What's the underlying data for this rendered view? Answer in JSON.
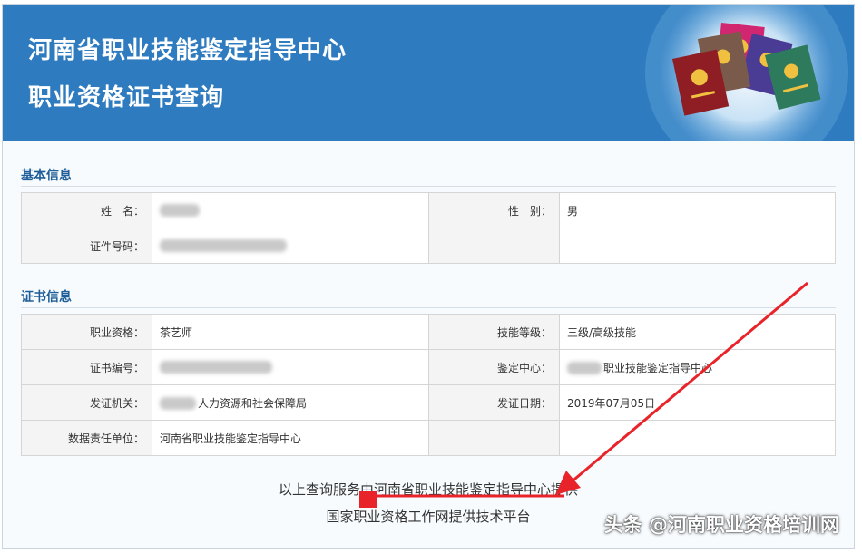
{
  "header": {
    "title_line1": "河南省职业技能鉴定指导中心",
    "title_line2": "职业资格证书查询"
  },
  "basic_info": {
    "section_title": "基本信息",
    "rows": [
      {
        "label": "姓　名：",
        "value": "",
        "label2": "性　别：",
        "value2": "男"
      },
      {
        "label": "证件号码：",
        "value": "",
        "label2": "",
        "value2": ""
      }
    ]
  },
  "cert_info": {
    "section_title": "证书信息",
    "rows": [
      {
        "label": "职业资格：",
        "value": "茶艺师",
        "label2": "技能等级：",
        "value2": "三级/高级技能"
      },
      {
        "label": "证书编号：",
        "value": "",
        "label2": "鉴定中心：",
        "value2": "职业技能鉴定指导中心"
      },
      {
        "label": "发证机关：",
        "value": "人力资源和社会保障局",
        "label2": "发证日期：",
        "value2": "2019年07月05日"
      },
      {
        "label": "数据责任单位：",
        "value": "河南省职业技能鉴定指导中心",
        "label2": "",
        "value2": ""
      }
    ]
  },
  "footer": {
    "line1": "以上查询服务由河南省职业技能鉴定指导中心提供",
    "line2": "国家职业资格工作网提供技术平台"
  },
  "watermark": "头条 @河南职业资格培训网",
  "colors": {
    "header_bg": "#2f7bbf",
    "section_title": "#1f5e98",
    "annotation_red": "#e8242a"
  },
  "icons": {
    "header_art": "certificate-books-illustration",
    "redaction": "blurred-redaction",
    "annotation": "red-arrow"
  }
}
